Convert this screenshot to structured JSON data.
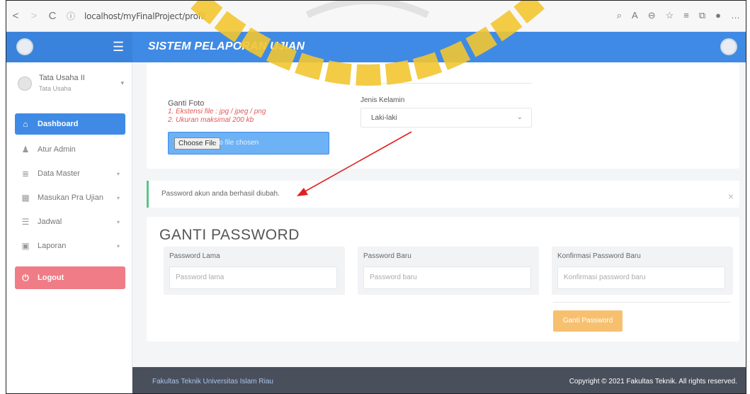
{
  "browser": {
    "back": "<",
    "forward": ">",
    "reload": "C",
    "info": "ⓘ",
    "url": "localhost/myFinalProject/profil",
    "right_icons": [
      "search-icon",
      "read-aloud-icon",
      "zoom-icon",
      "favorite-icon",
      "favorites-bar-icon",
      "collections-icon",
      "profile-icon",
      "more-icon"
    ]
  },
  "header": {
    "title": "SISTEM PELAPORAN UJIAN",
    "menu_icon": "☰"
  },
  "sidebar": {
    "user_name": "Tata Usaha II",
    "user_role": "Tata Usaha",
    "items": [
      {
        "label": "Dashboard",
        "icon": "home-icon",
        "glyph": "⌂",
        "active": true,
        "caret": false
      },
      {
        "label": "Atur Admin",
        "icon": "user-icon",
        "glyph": "♟",
        "active": false,
        "caret": false
      },
      {
        "label": "Data Master",
        "icon": "database-icon",
        "glyph": "≣",
        "active": false,
        "caret": true
      },
      {
        "label": "Masukan Pra Ujian",
        "icon": "keyboard-icon",
        "glyph": "▦",
        "active": false,
        "caret": true
      },
      {
        "label": "Jadwal",
        "icon": "list-icon",
        "glyph": "☰",
        "active": false,
        "caret": true
      },
      {
        "label": "Laporan",
        "icon": "save-icon",
        "glyph": "▣",
        "active": false,
        "caret": true
      },
      {
        "label": "Logout",
        "icon": "power-icon",
        "glyph": "⏻",
        "active": false,
        "caret": false
      }
    ]
  },
  "profile": {
    "photo_label": "Ganti Foto",
    "photo_note_1": "1. Ekstensi file : jpg / jpeg / png",
    "photo_note_2": "2. Ukuran maksimal 200 kb",
    "choose_file": "Choose File",
    "no_file": "No file chosen",
    "gender_label": "Jenis Kelamin",
    "gender_value": "Laki-laki"
  },
  "alert": {
    "message": "Password akun anda berhasil diubah.",
    "close": "×"
  },
  "password": {
    "title": "GANTI PASSWORD",
    "old_label": "Password Lama",
    "old_placeholder": "Password lama",
    "new_label": "Password Baru",
    "new_placeholder": "Password baru",
    "confirm_label": "Konfirmasi Password Baru",
    "confirm_placeholder": "Konfirmasi password baru",
    "submit": "Ganti Password"
  },
  "footer": {
    "left": "Fakultas Teknik Universitas Islam Riau",
    "right": "Copyright © 2021 Fakultas Teknik. All rights reserved."
  },
  "colors": {
    "primary": "#3f8ae5",
    "danger": "#ef7c86",
    "warning": "#f7c06f",
    "success": "#5cc48a",
    "footer": "#4a4f5c",
    "annotation_arrow": "#e02020"
  }
}
